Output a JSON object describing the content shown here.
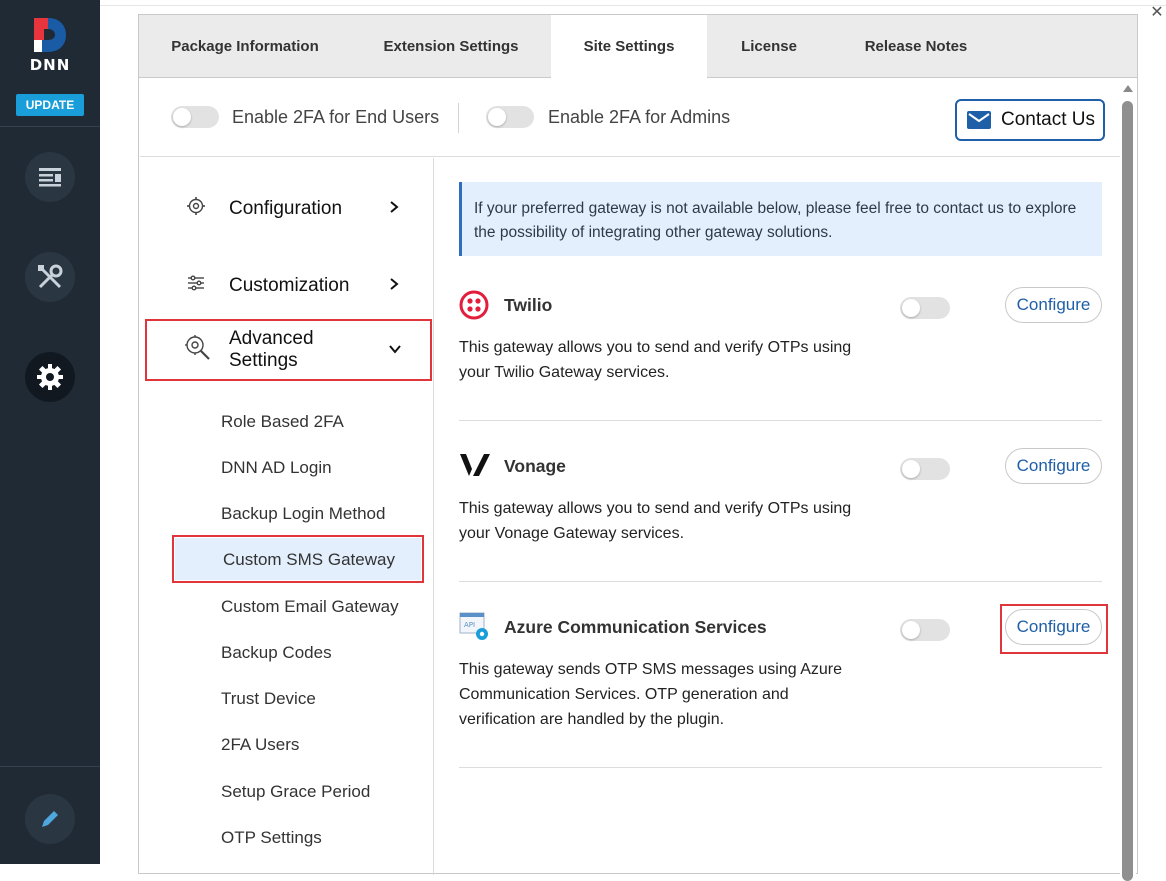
{
  "sidebar": {
    "logo_text": "DNN",
    "update_label": "UPDATE",
    "icons": [
      "content-icon",
      "tools-icon",
      "settings-icon",
      "edit-icon"
    ]
  },
  "tabs": [
    {
      "label": "Package Information"
    },
    {
      "label": "Extension Settings"
    },
    {
      "label": "Site Settings"
    },
    {
      "label": "License"
    },
    {
      "label": "Release Notes"
    }
  ],
  "toggles": {
    "end_users_label": "Enable 2FA for End Users",
    "admins_label": "Enable 2FA for Admins"
  },
  "contact_label": "Contact Us",
  "menu": {
    "configuration": "Configuration",
    "customization": "Customization",
    "advanced_line1": "Advanced",
    "advanced_line2": "Settings",
    "sub_items": [
      "Role Based 2FA",
      "DNN AD Login",
      "Backup Login Method",
      "Custom SMS Gateway",
      "Custom Email Gateway",
      "Backup Codes",
      "Trust Device",
      "2FA Users",
      "Setup Grace Period",
      "OTP Settings"
    ]
  },
  "info_text": "If your preferred gateway is not available below, please feel free to contact us to explore the possibility of integrating other gateway solutions.",
  "gateways": [
    {
      "name": "Twilio",
      "desc": "This gateway allows you to send and verify OTPs using your Twilio Gateway services.",
      "button": "Configure"
    },
    {
      "name": "Vonage",
      "desc": "This gateway allows you to send and verify OTPs using your Vonage Gateway services.",
      "button": "Configure"
    },
    {
      "name": "Azure Communication Services",
      "desc": "This gateway sends OTP SMS messages using Azure Communication Services. OTP generation and verification are handled by the plugin.",
      "button": "Configure"
    }
  ]
}
